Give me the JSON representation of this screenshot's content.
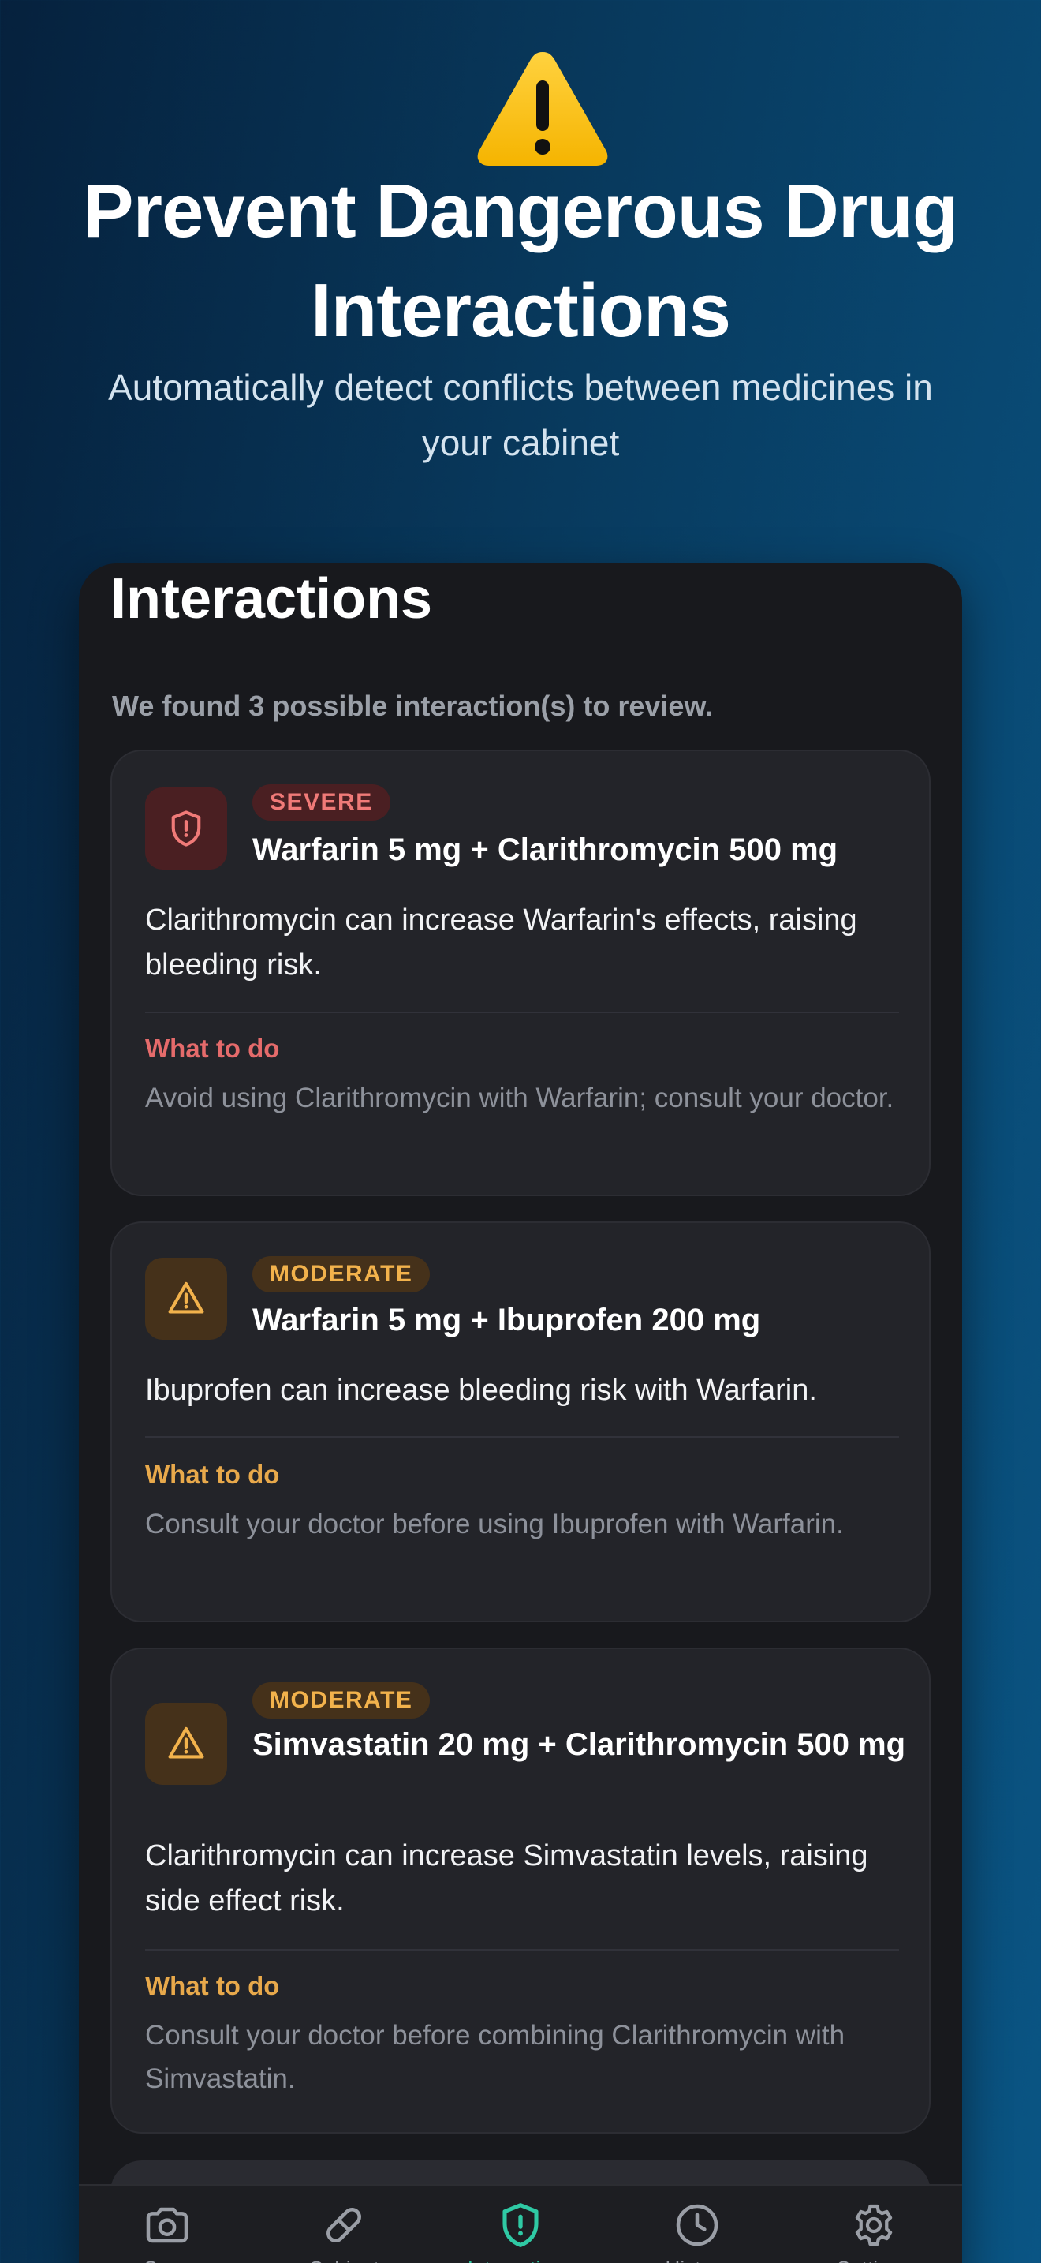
{
  "hero": {
    "title": "Prevent Dangerous Drug Interactions",
    "subtitle": "Automatically detect conflicts between medicines in your cabinet"
  },
  "panel": {
    "title": "Interactions",
    "summary": "We found 3 possible interaction(s) to review."
  },
  "interactions": [
    {
      "severity": "SEVERE",
      "title": "Warfarin 5 mg + Clarithromycin 500 mg",
      "description": "Clarithromycin can increase Warfarin's effects, raising bleeding risk.",
      "todo_label": "What to do",
      "todo_text": "Avoid using Clarithromycin with Warfarin; consult your doctor."
    },
    {
      "severity": "MODERATE",
      "title": "Warfarin 5 mg + Ibuprofen 200 mg",
      "description": "Ibuprofen can increase bleeding risk with Warfarin.",
      "todo_label": "What to do",
      "todo_text": "Consult your doctor before using Ibuprofen with Warfarin."
    },
    {
      "severity": "MODERATE",
      "title": "Simvastatin 20 mg + Clarithromycin 500 mg",
      "description": "Clarithromycin can increase Simvastatin levels, raising side effect risk.",
      "todo_label": "What to do",
      "todo_text": "Consult your doctor before combining Clarithromycin with Simvastatin."
    }
  ],
  "tabbar": {
    "active": "interactions",
    "tabs": [
      {
        "icon": "camera-icon",
        "label": "Scan"
      },
      {
        "icon": "pill-icon",
        "label": "Cabinet"
      },
      {
        "icon": "shield-alert-icon",
        "label": "Interactions"
      },
      {
        "icon": "clock-icon",
        "label": "History"
      },
      {
        "icon": "gear-icon",
        "label": "Settings"
      }
    ]
  },
  "colors": {
    "severe": "#f07a78",
    "moderate": "#f2b24c",
    "accent": "#2fc9a4"
  }
}
